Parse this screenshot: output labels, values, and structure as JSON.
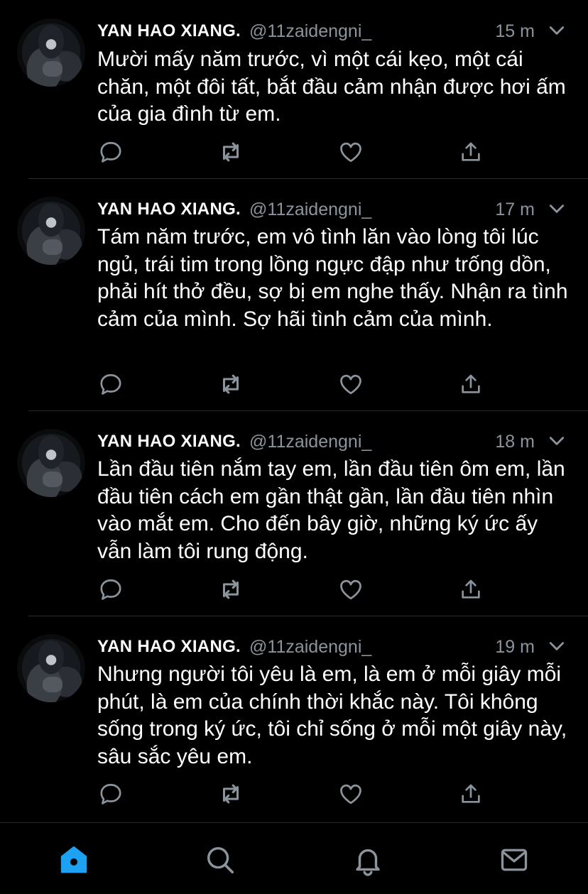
{
  "tweets": [
    {
      "name": "YAN HAO XIANG.",
      "handle": "@11zaidengni_",
      "time": "15 m",
      "text": "Mười mấy năm trước, vì một cái kẹo, một cái chăn, một đôi tất, bắt đầu cảm nhận được hơi ấm của gia đình từ em."
    },
    {
      "name": "YAN HAO XIANG.",
      "handle": "@11zaidengni_",
      "time": "17 m",
      "text": "Tám năm trước, em vô tình lăn vào lòng tôi lúc ngủ, trái tim trong lồng ngực đập như trống dồn, phải hít thở đều, sợ bị em nghe thấy. Nhận ra tình cảm của mình. Sợ hãi tình cảm của mình."
    },
    {
      "name": "YAN HAO XIANG.",
      "handle": "@11zaidengni_",
      "time": "18 m",
      "text": "Lần đầu tiên nắm tay em, lần đầu tiên ôm em, lần đầu tiên cách em gần thật gần, lần đầu tiên nhìn vào mắt em. Cho đến bây giờ, những ký ức ấy vẫn làm tôi rung động."
    },
    {
      "name": "YAN HAO XIANG.",
      "handle": "@11zaidengni_",
      "time": "19 m",
      "text": "Nhưng người tôi yêu là em, là em ở mỗi giây mỗi phút, là em của chính thời khắc này. Tôi không sống trong ký ức, tôi chỉ sống ở mỗi một giây này, sâu sắc yêu em."
    }
  ],
  "icons": {
    "reply": "reply-icon",
    "retweet": "retweet-icon",
    "like": "like-icon",
    "share": "share-icon",
    "more": "chevron-down-icon"
  },
  "tabbar": {
    "items": [
      "home-icon",
      "search-icon",
      "notifications-icon",
      "messages-icon"
    ],
    "active_color": "#1da1f2",
    "inactive_color": "#8b949c"
  },
  "colors": {
    "background": "#000000",
    "text": "#ffffff",
    "secondary": "#8b949c"
  }
}
